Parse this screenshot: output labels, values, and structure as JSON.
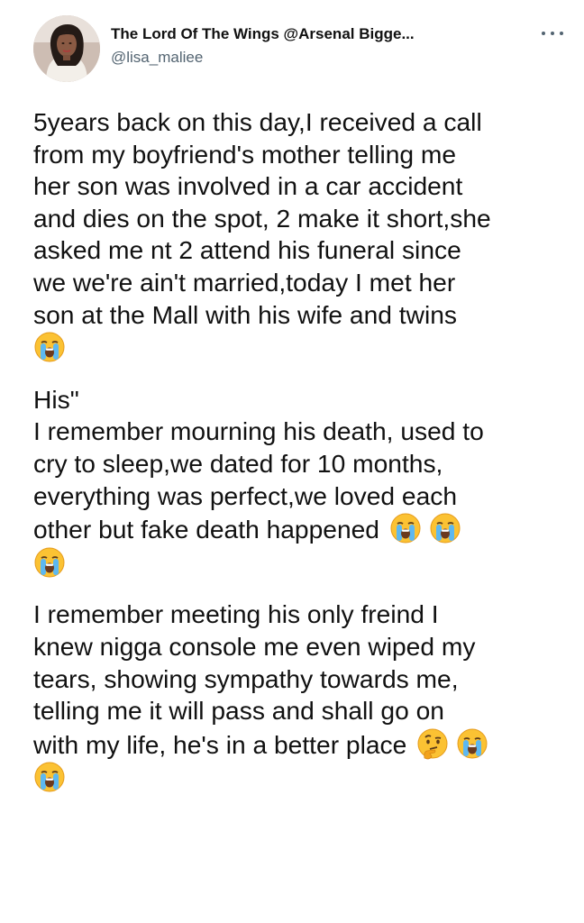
{
  "tweet": {
    "author": {
      "display_name": "The Lord Of The Wings @Arsenal Bigge...",
      "handle": "@lisa_maliee",
      "avatar_icon": "profile-photo"
    },
    "more_icon": "more-horizontal-icon",
    "paragraphs": [
      {
        "lines": [
          "5years back on this day,I received a call",
          "from my boyfriend's mother telling me",
          "her son was involved in a car accident",
          "and dies on the spot, 2 make it short,she",
          "asked me nt 2 attend his funeral since",
          "we we're ain't married,today I met her",
          "son at the Mall with his wife and twins"
        ]
      },
      {
        "lines": [
          "His\"",
          "I remember mourning his death, used to",
          "cry to sleep,we dated for 10 months,",
          "everything was perfect,we loved each",
          "other but fake death happened"
        ]
      },
      {
        "lines": [
          "I remember meeting his only freind I",
          "knew nigga console me even wiped my",
          "tears, showing sympathy towards me,",
          "telling me it will pass and shall go on",
          "with my life, he's in a better place"
        ]
      }
    ],
    "emojis": {
      "crying": "loudly-crying-face",
      "thinking": "thinking-face"
    }
  }
}
